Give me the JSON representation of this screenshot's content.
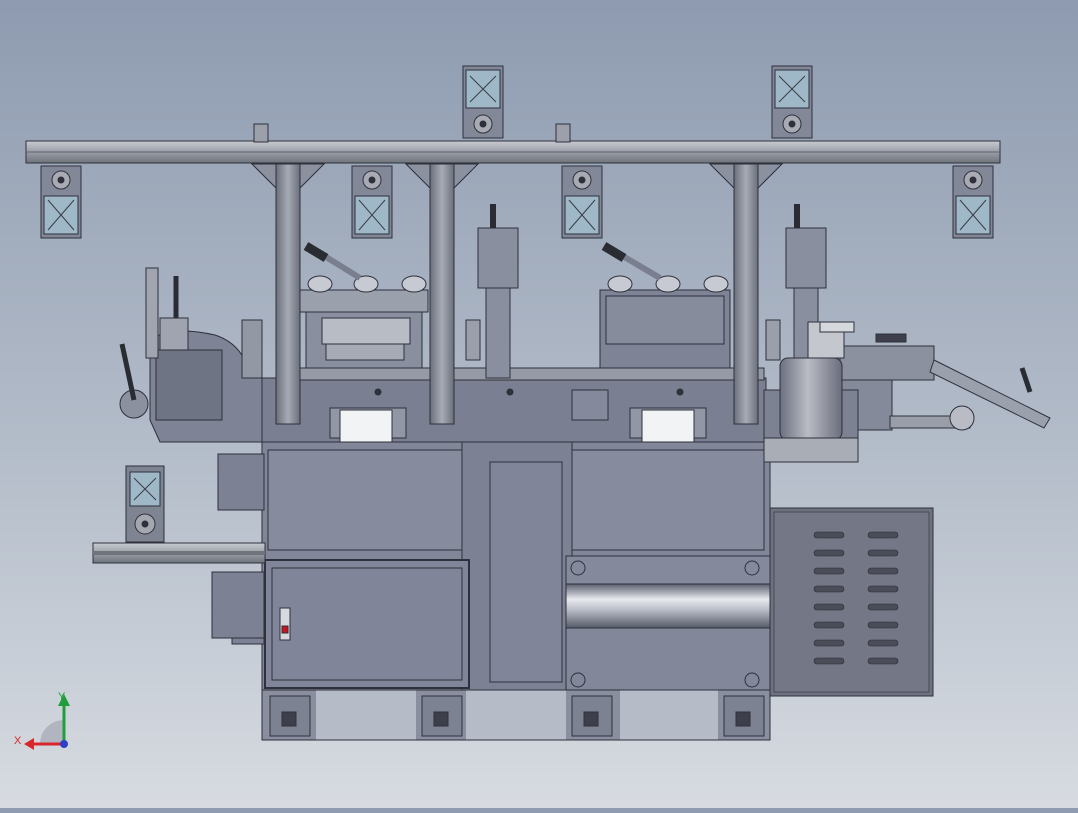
{
  "triad": {
    "x_label": "X",
    "y_label": "Y",
    "x_color": "#d8262b",
    "y_color": "#1f9e3a",
    "z_color": "#2d3fc7"
  },
  "colors": {
    "frame": "#7a7f91",
    "frame_dark": "#4f5362",
    "panel": "#858a9c",
    "rail": "#a9adb5",
    "roller_glass": "#9fb8c8",
    "accent_red": "#c8151c"
  }
}
